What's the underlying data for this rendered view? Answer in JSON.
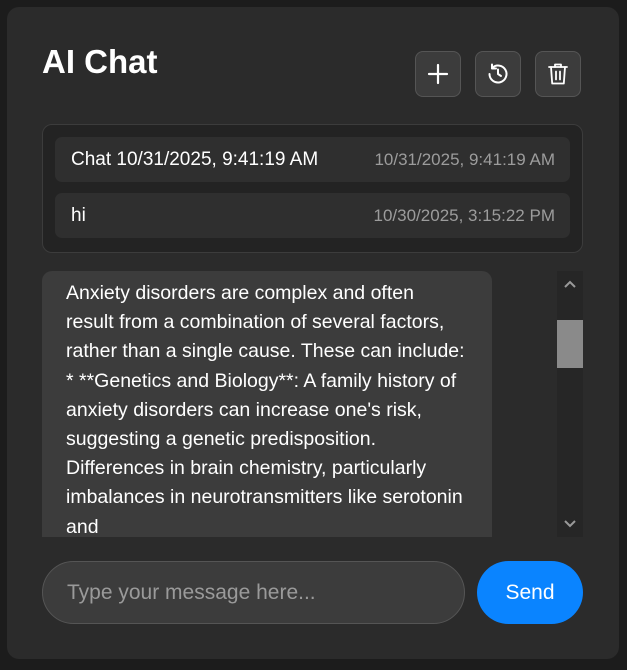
{
  "header": {
    "title": "AI Chat",
    "actions": [
      {
        "name": "new-chat-button",
        "icon": "plus-icon"
      },
      {
        "name": "history-button",
        "icon": "history-icon"
      },
      {
        "name": "delete-button",
        "icon": "trash-icon"
      }
    ]
  },
  "history": [
    {
      "title": "Chat 10/31/2025, 9:41:19 AM",
      "time": "10/31/2025, 9:41:19 AM"
    },
    {
      "title": "hi",
      "time": "10/30/2025, 3:15:22 PM"
    }
  ],
  "messages": [
    {
      "role": "assistant",
      "text": "Anxiety disorders are complex and often result from a combination of several factors, rather than a single cause. These can include: * **Genetics and Biology**: A family history of anxiety disorders can increase one's risk, suggesting a genetic predisposition. Differences in brain chemistry, particularly imbalances in neurotransmitters like serotonin and"
    }
  ],
  "composer": {
    "placeholder": "Type your message here...",
    "value": "",
    "send_label": "Send"
  },
  "colors": {
    "background": "#1c1c1c",
    "panel": "#2b2b2b",
    "accent": "#0a84ff",
    "muted_text": "#9c9c9c"
  }
}
